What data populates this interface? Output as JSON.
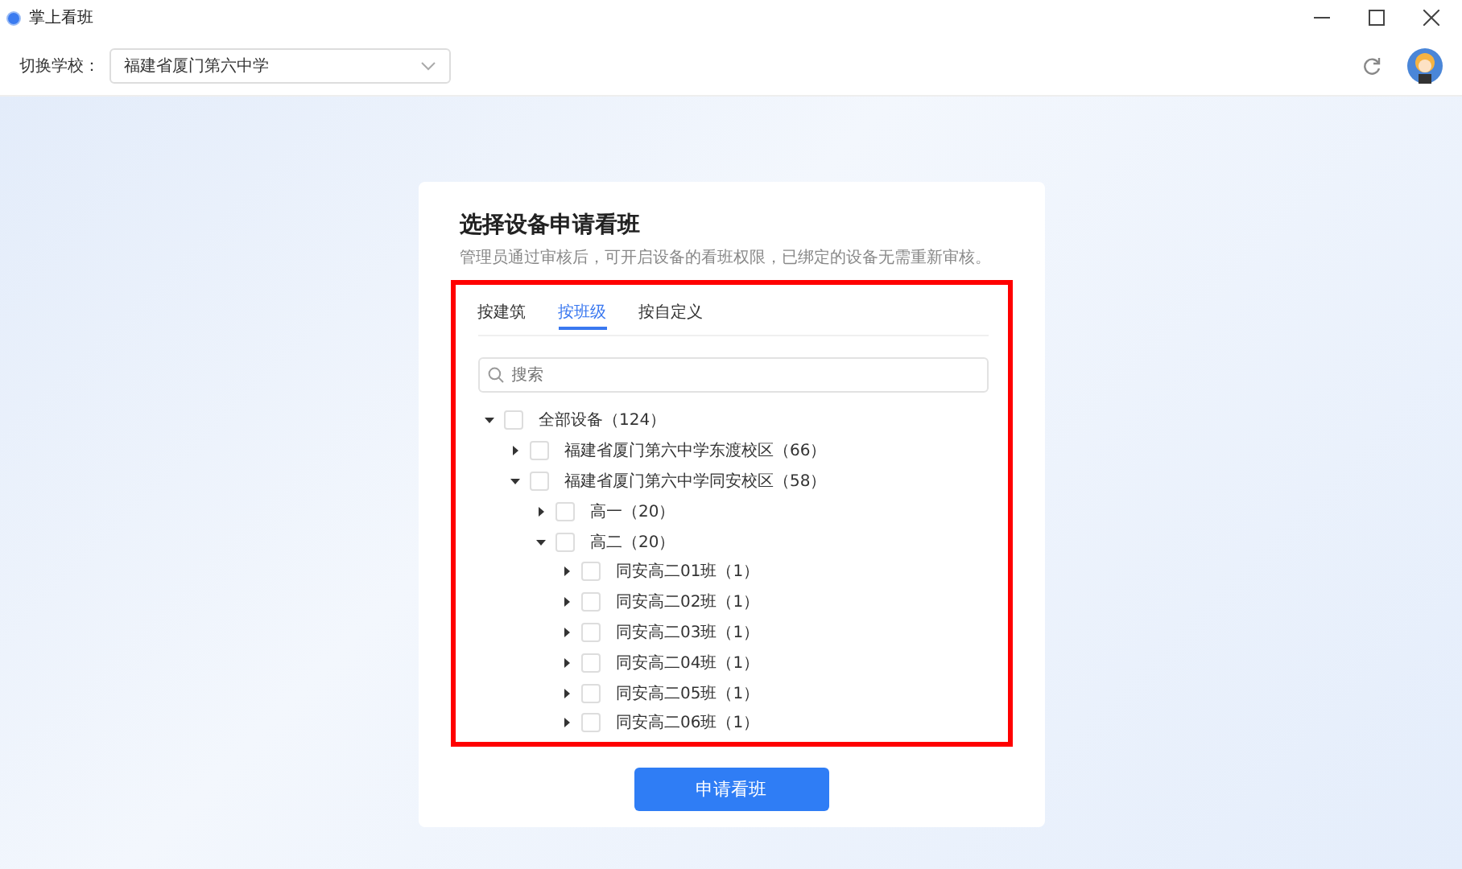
{
  "window": {
    "title": "掌上看班"
  },
  "toolbar": {
    "school_label": "切换学校：",
    "school_value": "福建省厦门第六中学"
  },
  "card": {
    "title": "选择设备申请看班",
    "subtitle": "管理员通过审核后，可开启设备的看班权限，已绑定的设备无需重新审核。",
    "tabs": [
      {
        "label": "按建筑",
        "selected": false
      },
      {
        "label": "按班级",
        "selected": true
      },
      {
        "label": "按自定义",
        "selected": false
      }
    ],
    "search": {
      "placeholder": "搜索"
    },
    "tree": [
      {
        "label": "全部设备（124）",
        "expanded": true,
        "checked": false,
        "children": [
          {
            "label": "福建省厦门第六中学东渡校区（66）",
            "expanded": false,
            "checked": false
          },
          {
            "label": "福建省厦门第六中学同安校区（58）",
            "expanded": true,
            "checked": false,
            "children": [
              {
                "label": "高一（20）",
                "expanded": false,
                "checked": false
              },
              {
                "label": "高二（20）",
                "expanded": true,
                "checked": false,
                "children": [
                  {
                    "label": "同安高二01班（1）",
                    "expanded": false,
                    "checked": false
                  },
                  {
                    "label": "同安高二02班（1）",
                    "expanded": false,
                    "checked": false
                  },
                  {
                    "label": "同安高二03班（1）",
                    "expanded": false,
                    "checked": false
                  },
                  {
                    "label": "同安高二04班（1）",
                    "expanded": false,
                    "checked": false
                  },
                  {
                    "label": "同安高二05班（1）",
                    "expanded": false,
                    "checked": false
                  },
                  {
                    "label": "同安高二06班（1）",
                    "expanded": false,
                    "checked": false
                  }
                ]
              }
            ]
          }
        ]
      }
    ],
    "button": "申请看班"
  }
}
